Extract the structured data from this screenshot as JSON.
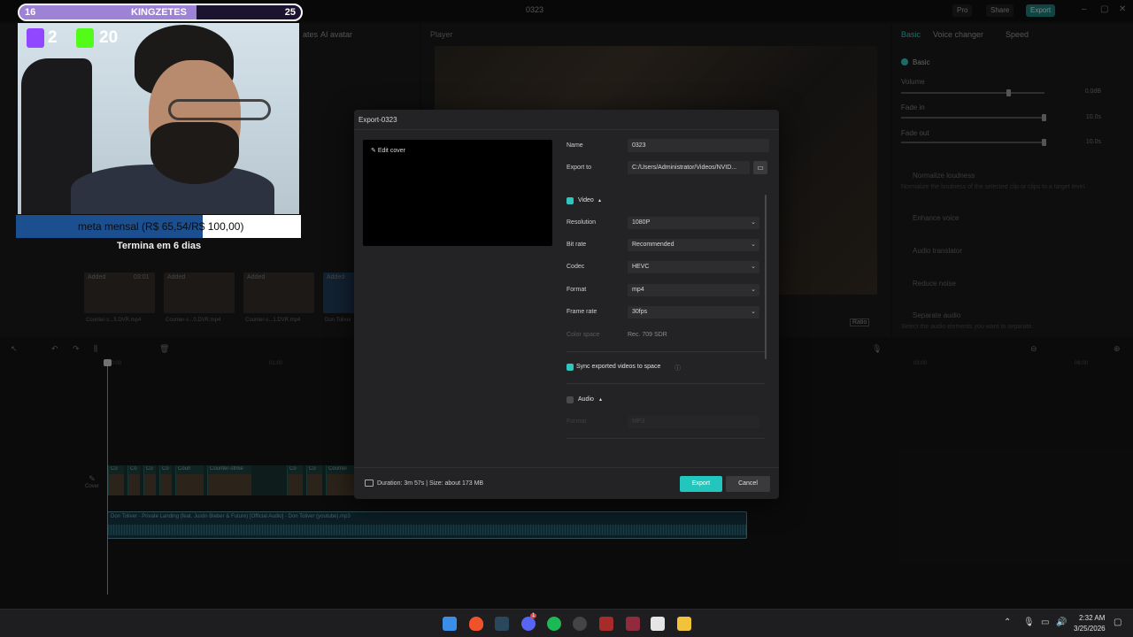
{
  "app": {
    "title": "0323",
    "top_buttons": {
      "pro": "Pro",
      "share": "Share",
      "export": "Export"
    }
  },
  "media": {
    "tabs": [
      "ates",
      "AI avatar"
    ],
    "thumbs": [
      {
        "added": "Added",
        "caption": "Counter-s...5.DVR.mp4"
      },
      {
        "added": "Added",
        "caption": "Counter-s...0.DVR.mp4"
      },
      {
        "added": "Added",
        "caption": "Counter-s...1.DVR.mp4"
      },
      {
        "added": "Added",
        "caption": "Don Toliver"
      }
    ],
    "duration_badge": "03:01"
  },
  "player": {
    "label": "Player",
    "controls": [
      "Ratio"
    ]
  },
  "props": {
    "tabs": [
      "Basic",
      "Voice changer",
      "Speed"
    ],
    "basic_label": "Basic",
    "volume_label": "Volume",
    "volume_val": "0.0dB",
    "fadein_label": "Fade in",
    "fadein_val": "10.0s",
    "fadeout_label": "Fade out",
    "fadeout_val": "10.0s",
    "normalize": "Normalize loudness",
    "normalize_desc": "Normalize the loudness of the selected clip or clips to a target level.",
    "enhance": "Enhance voice",
    "translator": "Audio translator",
    "noise": "Reduce noise",
    "separate": "Separate audio",
    "separate_desc": "Select the audio elements you want to separate."
  },
  "timeline": {
    "ticks": [
      "00:00",
      "01:00",
      "03:00",
      "06:00"
    ],
    "clip_labels": [
      "Co",
      "Co",
      "Co",
      "Co",
      "Coun",
      "Counter-strike",
      "Co",
      "Co",
      "Counter",
      "Co",
      "Cou",
      "Co"
    ],
    "audio_title": "Don Toliver - Private Landing (feat. Justin Bieber & Future) [Official Audio] - Don Toliver (youtube).mp3",
    "cover": "Cover"
  },
  "dialog": {
    "title": "Export-0323",
    "edit_cover": "Edit cover",
    "name_label": "Name",
    "name_value": "0323",
    "export_to_label": "Export to",
    "export_to_value": "C:/Users/Administrator/Videos/NVID...",
    "video_section": "Video",
    "resolution_label": "Resolution",
    "resolution_value": "1080P",
    "bitrate_label": "Bit rate",
    "bitrate_value": "Recommended",
    "codec_label": "Codec",
    "codec_value": "HEVC",
    "format_label": "Format",
    "format_value": "mp4",
    "framerate_label": "Frame rate",
    "framerate_value": "30fps",
    "colorspace_label": "Color space",
    "colorspace_value": "Rec. 709 SDR",
    "sync_label": "Sync exported videos to space",
    "audio_section": "Audio",
    "audio_format_label": "Format",
    "audio_format_value": "MP3",
    "duration": "Duration: 3m 57s | Size: about 173 MB",
    "export_btn": "Export",
    "cancel_btn": "Cancel"
  },
  "stream_overlay": {
    "left_num": "16",
    "name": "KINGZETES",
    "right_num": "25",
    "twitch_count": "2",
    "kick_count": "20",
    "goal_text": "meta mensal (R$ 65,54/R$ 100,00)",
    "goal_fraction": 0.6554,
    "goal_ends": "Termina em 6 dias"
  },
  "taskbar": {
    "time": "2:32 AM",
    "date": "3/25/2026",
    "discord_badge": "1"
  }
}
